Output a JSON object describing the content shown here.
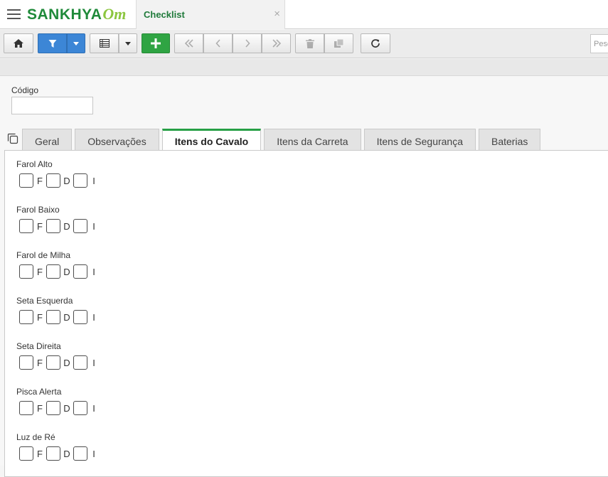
{
  "header": {
    "logo_main": "SANKHYA",
    "logo_suffix": "Om",
    "tab_title": "Checklist",
    "tab_close": "×"
  },
  "toolbar": {
    "search_placeholder": "Pesq"
  },
  "form": {
    "codigo_label": "Código",
    "codigo_value": ""
  },
  "tabs": [
    {
      "label": "Geral"
    },
    {
      "label": "Observações"
    },
    {
      "label": "Itens do Cavalo"
    },
    {
      "label": "Itens da Carreta"
    },
    {
      "label": "Itens de Segurança"
    },
    {
      "label": "Baterias"
    }
  ],
  "active_tab": "Itens do Cavalo",
  "items": [
    {
      "label": "Farol Alto",
      "options": [
        "F",
        "D",
        "I"
      ]
    },
    {
      "label": "Farol Baixo",
      "options": [
        "F",
        "D",
        "I"
      ]
    },
    {
      "label": "Farol de Milha",
      "options": [
        "F",
        "D",
        "I"
      ]
    },
    {
      "label": "Seta Esquerda",
      "options": [
        "F",
        "D",
        "I"
      ]
    },
    {
      "label": "Seta Direita",
      "options": [
        "F",
        "D",
        "I"
      ]
    },
    {
      "label": "Pisca Alerta",
      "options": [
        "F",
        "D",
        "I"
      ]
    },
    {
      "label": "Luz de Ré",
      "options": [
        "F",
        "D",
        "I"
      ]
    }
  ],
  "colors": {
    "brand_green": "#1f8a3a",
    "accent_light_green": "#8cc63f",
    "filter_blue": "#3c86d6",
    "add_green": "#2fa443",
    "active_tab_border": "#27a046"
  },
  "icons": [
    "menu-icon",
    "home-icon",
    "filter-icon",
    "chevron-down-icon",
    "grid-icon",
    "plus-icon",
    "first-page-icon",
    "prev-page-icon",
    "next-page-icon",
    "last-page-icon",
    "trash-icon",
    "duplicate-icon",
    "refresh-icon",
    "copy-icon"
  ]
}
